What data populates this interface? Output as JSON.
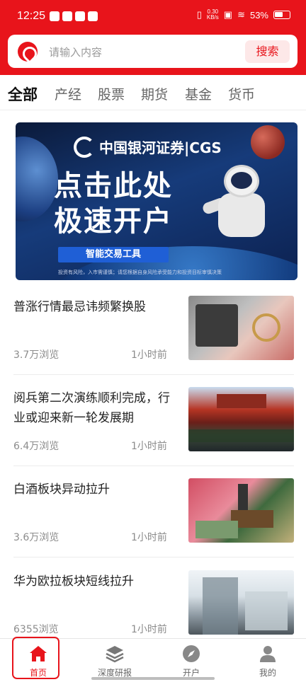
{
  "status_bar": {
    "time": "12:25",
    "net_speed_line1": "0.30",
    "net_speed_line2": "KB/s",
    "battery": "53%"
  },
  "header": {
    "search_placeholder": "请输入内容",
    "search_button": "搜索",
    "accent_color": "#e8141b"
  },
  "tabs": [
    {
      "label": "全部",
      "active": true
    },
    {
      "label": "产经",
      "active": false
    },
    {
      "label": "股票",
      "active": false
    },
    {
      "label": "期货",
      "active": false
    },
    {
      "label": "基金",
      "active": false
    },
    {
      "label": "货币",
      "active": false
    }
  ],
  "banner": {
    "brand": "中国银河证券|CGS",
    "headline_line1": "点击此处",
    "headline_line2": "极速开户",
    "pill": "智能交易工具",
    "fine_print": "投资有风险，入市需谨慎；请您根据自身风险承受能力和投资目标审慎决策"
  },
  "news": [
    {
      "title": "普涨行情最忌讳频繁换股",
      "views": "3.7万浏览",
      "time": "1小时前",
      "thumb": "calculator-money-image"
    },
    {
      "title": "阅兵第二次演练顺利完成，行业或迎来新一轮发展期",
      "views": "6.4万浏览",
      "time": "1小时前",
      "thumb": "tiananmen-parade-image"
    },
    {
      "title": "白酒板块异动拉升",
      "views": "3.6万浏览",
      "time": "1小时前",
      "thumb": "abacus-money-image"
    },
    {
      "title": "华为欧拉板块短线拉升",
      "views": "6355浏览",
      "time": "1小时前",
      "thumb": "office-buildings-image"
    }
  ],
  "bottom_nav": [
    {
      "label": "首页",
      "icon": "home-icon",
      "active": true
    },
    {
      "label": "深度研报",
      "icon": "layers-icon",
      "active": false
    },
    {
      "label": "开户",
      "icon": "compass-icon",
      "active": false
    },
    {
      "label": "我的",
      "icon": "user-icon",
      "active": false
    }
  ]
}
